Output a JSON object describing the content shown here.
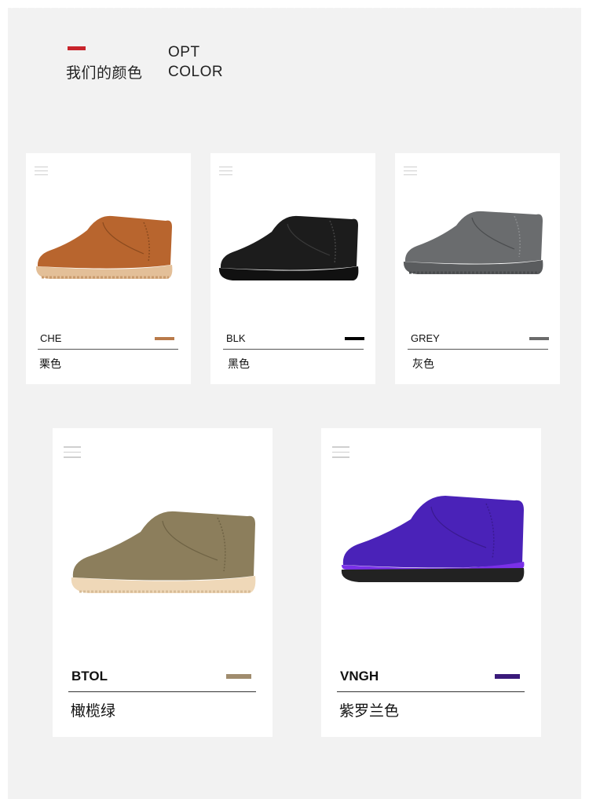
{
  "header": {
    "title_cn": "我们的颜色",
    "title_en_line1": "OPT",
    "title_en_line2": "COLOR",
    "accent": "#c8242b"
  },
  "colors": [
    {
      "code": "CHE",
      "name_cn": "栗色",
      "swatch": "#b97a4a",
      "upper": "#b8652e",
      "sole": "#e3bf98",
      "icon": "menu-icon"
    },
    {
      "code": "BLK",
      "name_cn": "黑色",
      "swatch": "#000000",
      "upper": "#1c1c1c",
      "sole": "#111111",
      "icon": "menu-icon"
    },
    {
      "code": "GREY",
      "name_cn": "灰色",
      "swatch": "#6b6b6b",
      "upper": "#6a6c6e",
      "sole": "#5a5c5e",
      "icon": "menu-icon"
    },
    {
      "code": "BTOL",
      "name_cn": "橄榄绿",
      "swatch": "#a08c6e",
      "upper": "#8c7e5c",
      "sole": "#efd8b8",
      "icon": "menu-icon"
    },
    {
      "code": "VNGH",
      "name_cn": "紫罗兰色",
      "swatch": "#3a1a7a",
      "upper": "#4a22b8",
      "sole": "#222222",
      "icon": "menu-icon"
    }
  ]
}
